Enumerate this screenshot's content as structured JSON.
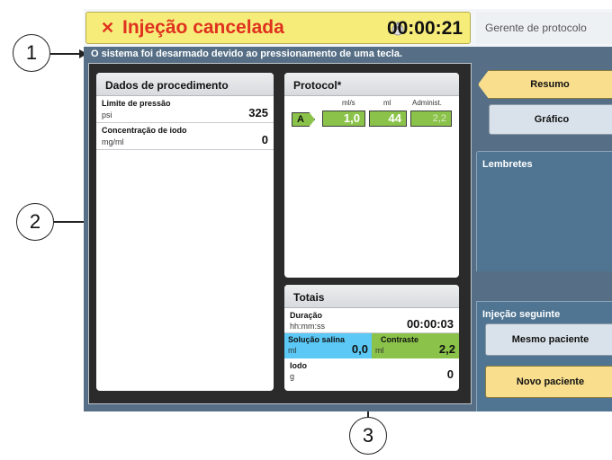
{
  "colors": {
    "status_bg": "#f6ec7a",
    "status_text": "#e0301e",
    "screen_bg": "#566f86",
    "phase_green": "#8bc34a",
    "saline_blue": "#5bc8f5",
    "contrast_green": "#8bc34a",
    "accent_yellow": "#f8de8d"
  },
  "callouts": [
    "1",
    "2",
    "3"
  ],
  "header": {
    "status_icon": "x-icon",
    "status_title": "Injeção cancelada",
    "timer_icon": "stopwatch-icon",
    "elapsed_time": "00:00:21",
    "protocol_manager": "Gerente de protocolo"
  },
  "message": "O sistema foi desarmado devido ao pressionamento de uma tecla.",
  "procedure": {
    "title": "Dados de procedimento",
    "pressure_limit": {
      "label": "Limite de pressão",
      "unit": "psi",
      "value": "325"
    },
    "iodine_concentration": {
      "label": "Concentração de iodo",
      "unit": "mg/ml",
      "value": "0"
    }
  },
  "protocol": {
    "title": "Protocol*",
    "columns": [
      "ml/s",
      "ml",
      "Administ."
    ],
    "phases": [
      {
        "label": "A",
        "rate": "1,0",
        "volume": "44",
        "administered": "2,2"
      }
    ]
  },
  "totals": {
    "title": "Totais",
    "duration": {
      "label": "Duração",
      "unit": "hh:mm:ss",
      "value": "00:00:03"
    },
    "saline": {
      "label": "Solução salina",
      "unit": "ml",
      "value": "0,0"
    },
    "contrast": {
      "label": "Contraste",
      "unit": "ml",
      "value": "2,2"
    },
    "iodine": {
      "label": "Iodo",
      "unit": "g",
      "value": "0"
    }
  },
  "right_panel": {
    "summary_button": "Resumo",
    "graph_button": "Gráfico",
    "reminders_title": "Lembretes",
    "next_injection_title": "Injeção seguinte",
    "same_patient_button": "Mesmo paciente",
    "new_patient_button": "Novo paciente"
  }
}
